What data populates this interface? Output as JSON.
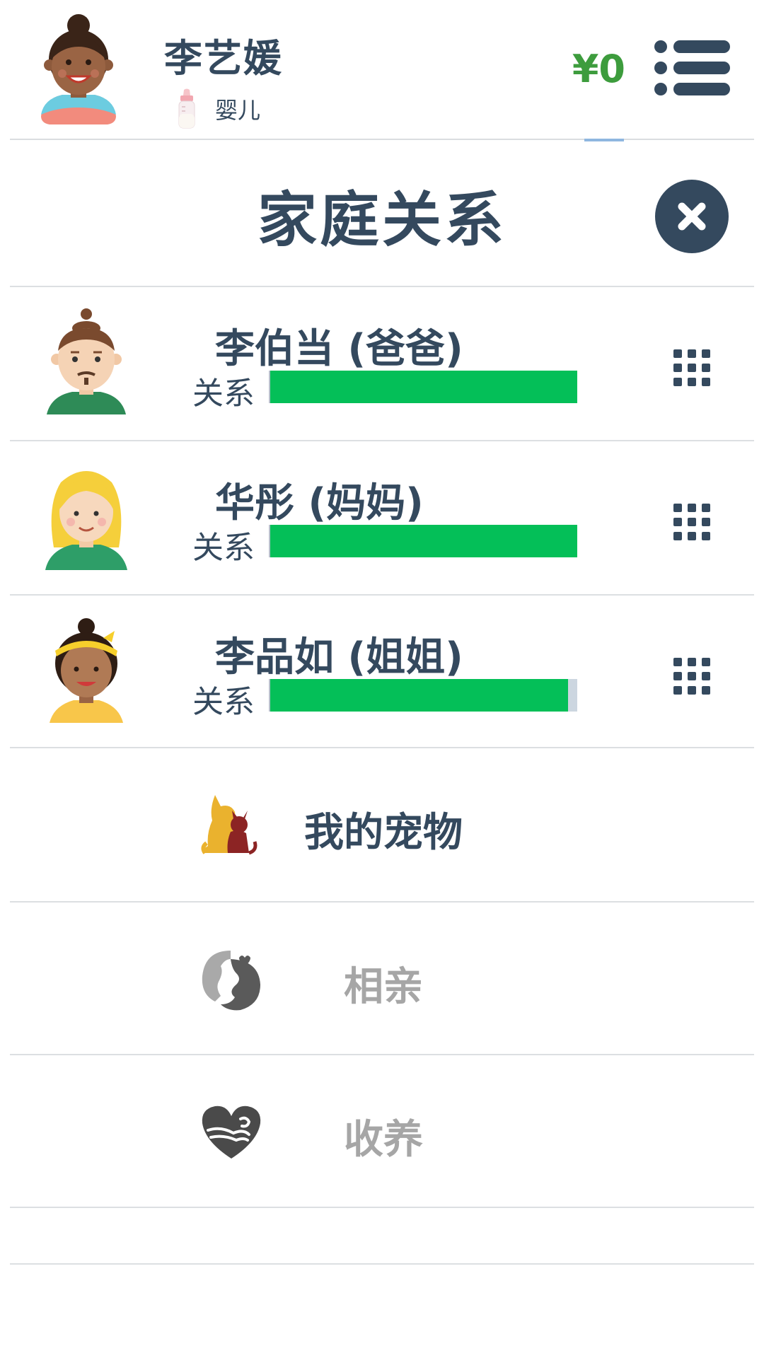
{
  "header": {
    "player_name": "李艺媛",
    "life_stage": "婴儿",
    "money": "¥0",
    "avatar_icon": "girl-avatar-icon",
    "stage_icon": "baby-bottle-icon",
    "menu_icon": "list-menu-icon",
    "money_color": "#3d9c3d"
  },
  "panel": {
    "title": "家庭关系",
    "close_icon": "close-icon"
  },
  "members": [
    {
      "name": "李伯当 (爸爸)",
      "relation_label": "关系",
      "relation_value": 100,
      "avatar_icon": "father-avatar-icon"
    },
    {
      "name": "华彤 (妈妈)",
      "relation_label": "关系",
      "relation_value": 100,
      "avatar_icon": "mother-avatar-icon"
    },
    {
      "name": "李品如 (姐姐)",
      "relation_label": "关系",
      "relation_value": 97,
      "avatar_icon": "sister-avatar-icon"
    }
  ],
  "actions": [
    {
      "label": "我的宠物",
      "icon": "pets-icon",
      "enabled": true
    },
    {
      "label": "相亲",
      "icon": "matchmaking-icon",
      "enabled": false
    },
    {
      "label": "收养",
      "icon": "adoption-heart-icon",
      "enabled": false
    }
  ],
  "colors": {
    "text_primary": "#34495e",
    "relation_bar": "#04bf58",
    "disabled_text": "#a6a6a6"
  }
}
